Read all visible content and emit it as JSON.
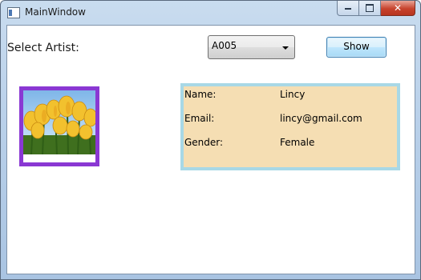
{
  "window": {
    "title": "MainWindow"
  },
  "form": {
    "select_label": "Select Artist:",
    "artist_combo_value": "A005",
    "show_label": "Show"
  },
  "details": {
    "name_label": "Name:",
    "name_value": "Lincy",
    "email_label": "Email:",
    "email_value": "lincy@gmail.com",
    "gender_label": "Gender:",
    "gender_value": "Female"
  },
  "colors": {
    "photo_border": "#8a38d3",
    "details_background": "#f5deb3",
    "details_border": "#a8d8e6"
  },
  "icons": [
    "window-app-icon",
    "minimize-icon",
    "maximize-icon",
    "close-icon",
    "dropdown-arrow-icon"
  ]
}
